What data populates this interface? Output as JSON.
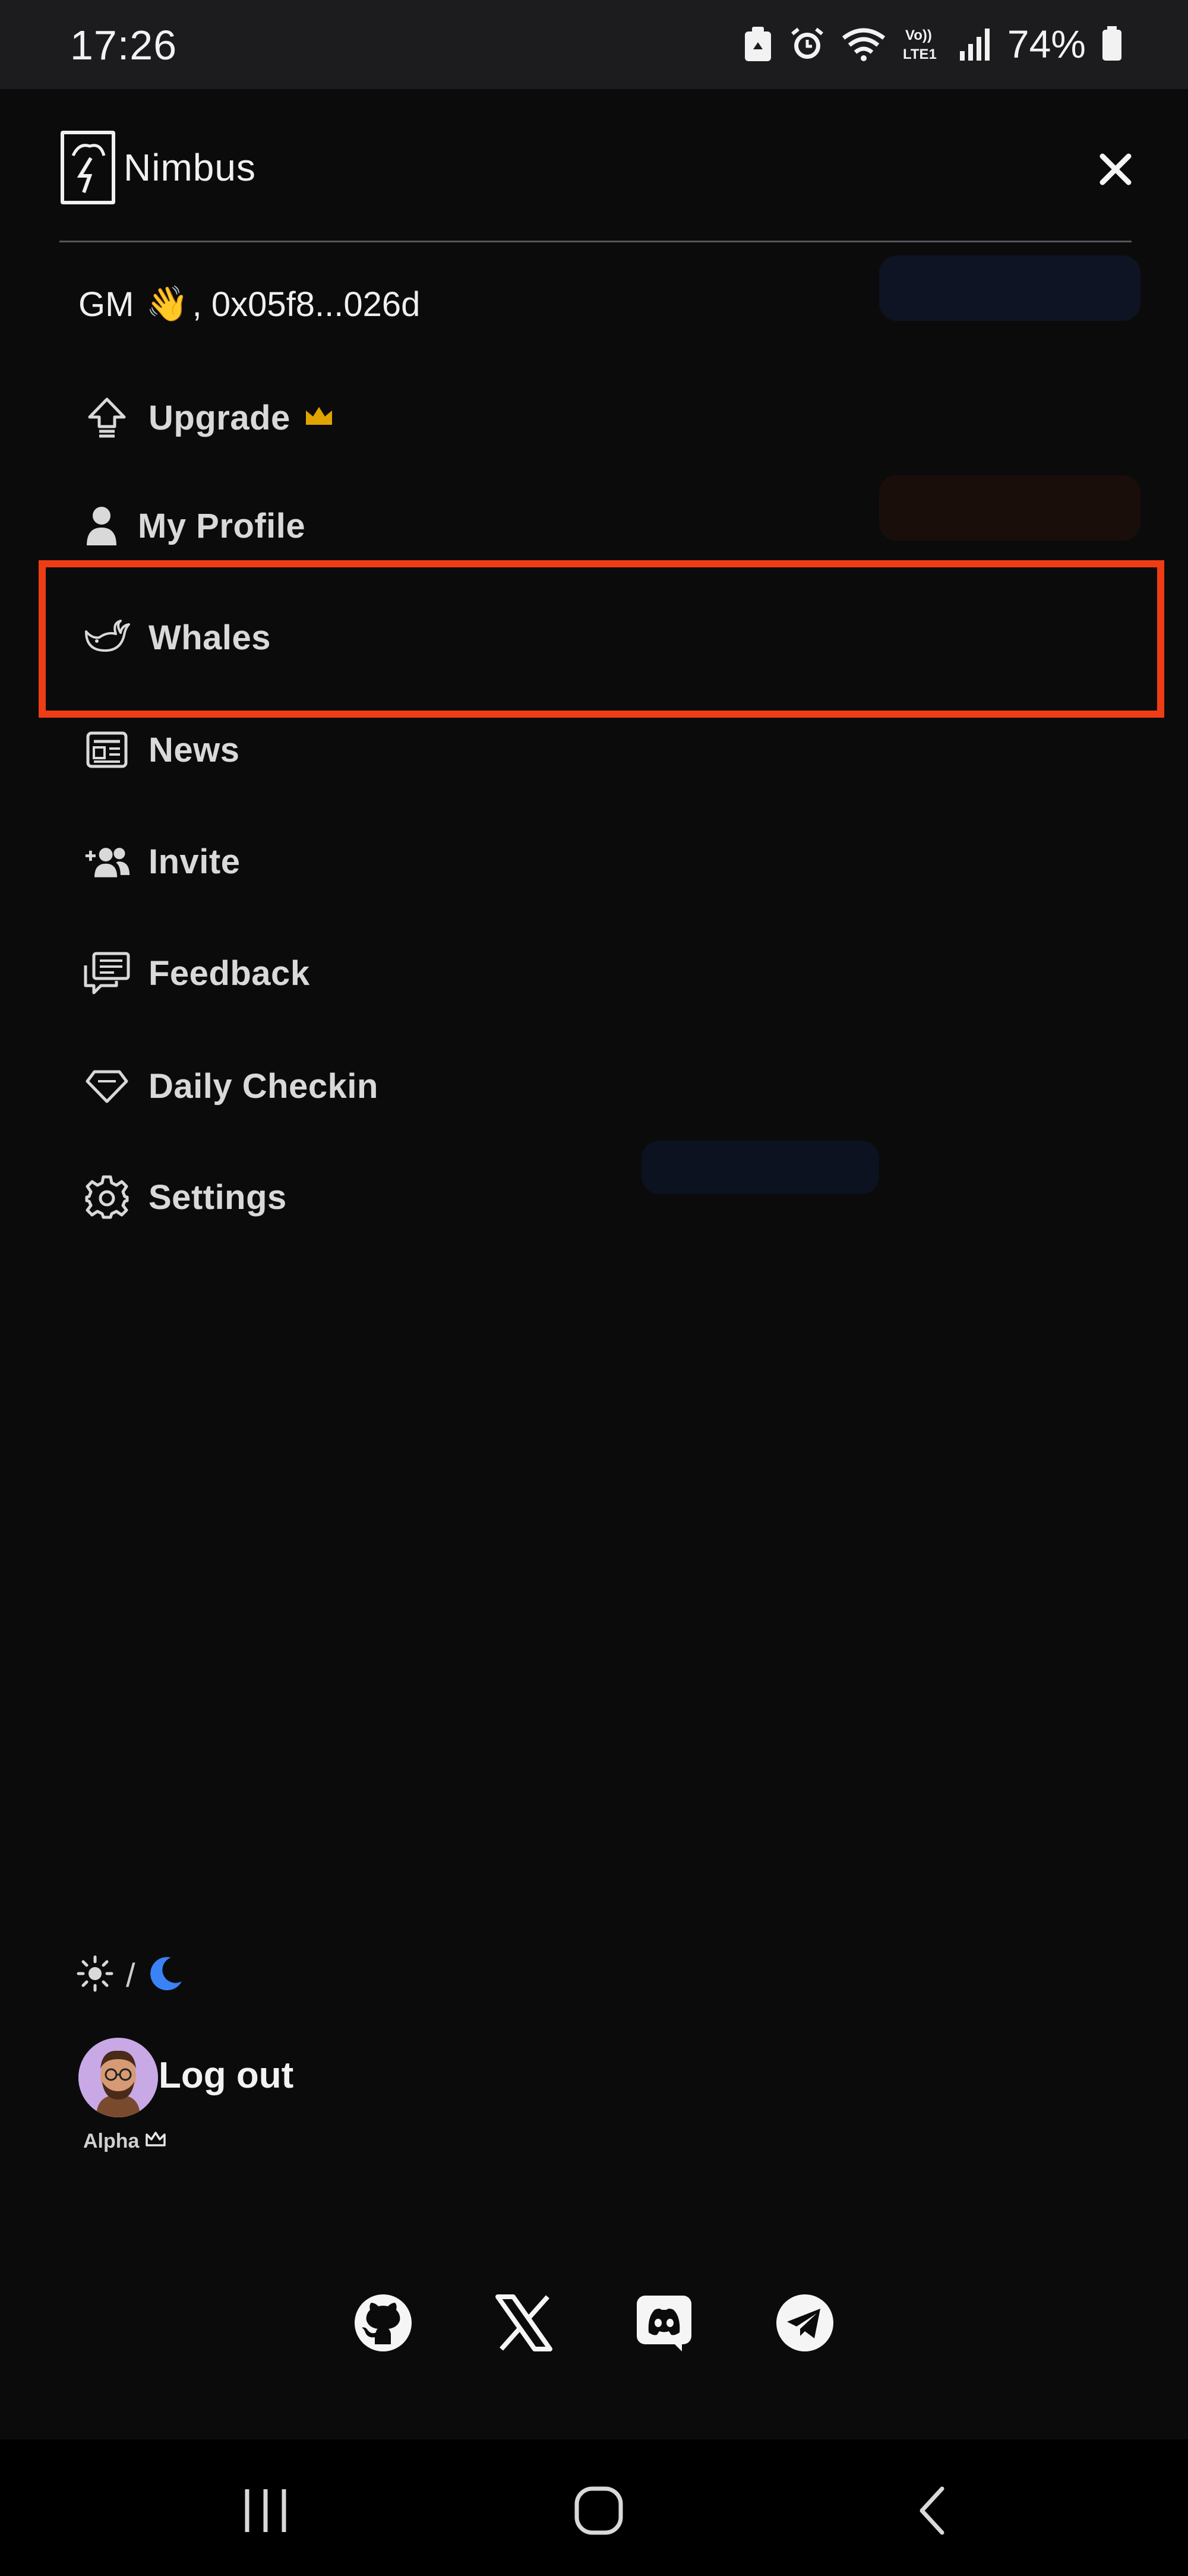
{
  "status_bar": {
    "time": "17:26",
    "icons": [
      "recycle-notification-icon",
      "alarm-icon",
      "wifi-icon",
      "volte-lte-icon",
      "signal-icon",
      "battery-icon"
    ],
    "volte_text": "Vo)) LTE1",
    "battery_percent": "74%"
  },
  "drawer": {
    "brand_name": "Nimbus",
    "greeting_prefix": "GM",
    "greeting_emoji": "👋",
    "greeting_address": ", 0x05f8...026d",
    "menu": [
      {
        "label": "Upgrade",
        "icon": "upgrade-arrow-icon",
        "badge": "crown-icon"
      },
      {
        "label": "My Profile",
        "icon": "user-icon"
      },
      {
        "label": "Whales",
        "icon": "whale-icon"
      },
      {
        "label": "News",
        "icon": "newspaper-icon"
      },
      {
        "label": "Invite",
        "icon": "add-users-icon"
      },
      {
        "label": "Feedback",
        "icon": "feedback-icon"
      },
      {
        "label": "Daily Checkin",
        "icon": "diamond-icon"
      },
      {
        "label": "Settings",
        "icon": "gear-icon"
      }
    ],
    "highlighted_item": "Whales",
    "theme_separator": "/",
    "logout_label": "Log out",
    "user_tier": "Alpha",
    "socials": [
      "github-icon",
      "x-icon",
      "discord-icon",
      "telegram-icon"
    ]
  },
  "colors": {
    "background": "#0b0b0c",
    "highlight": "#ee3d14",
    "crown": "#e0a400",
    "moon": "#3b82f6"
  },
  "nav_bar": [
    "recent-apps-icon",
    "home-icon",
    "back-icon"
  ]
}
